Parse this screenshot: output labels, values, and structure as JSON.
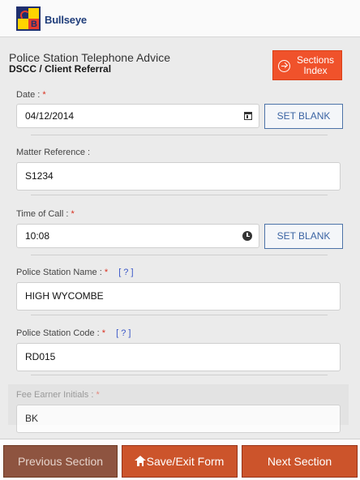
{
  "app": {
    "brand": "Bullseye",
    "logo_letter": "B"
  },
  "header": {
    "title": "Police Station Telephone Advice",
    "subtitle": "DSCC / Client Referral",
    "sections_button_line1": "Sections",
    "sections_button_line2": "Index"
  },
  "form": {
    "required_mark": "*",
    "help_text": "[ ? ]",
    "set_blank_label": "SET BLANK",
    "date": {
      "label": "Date :",
      "value": "04/12/2014",
      "icon": "calendar-icon"
    },
    "matter_reference": {
      "label": "Matter Reference :",
      "value": "S1234"
    },
    "time_of_call": {
      "label": "Time of Call :",
      "value": "10:08",
      "icon": "clock-icon"
    },
    "police_station_name": {
      "label": "Police Station Name :",
      "value": "HIGH WYCOMBE"
    },
    "police_station_code": {
      "label": "Police Station Code :",
      "value": "RD015"
    },
    "fee_earner_initials": {
      "label": "Fee Earner Initials :",
      "value": "BK"
    }
  },
  "footer": {
    "previous_label": "Previous Section",
    "save_exit_label": "Save/Exit Form",
    "next_label": "Next Section"
  },
  "colors": {
    "accent": "#f0522b",
    "footer_button": "#cc542b",
    "footer_button_disabled": "#8e5440",
    "set_blank_border": "#4d73a8",
    "required": "#d9301f",
    "help_link": "#3a57c8"
  }
}
